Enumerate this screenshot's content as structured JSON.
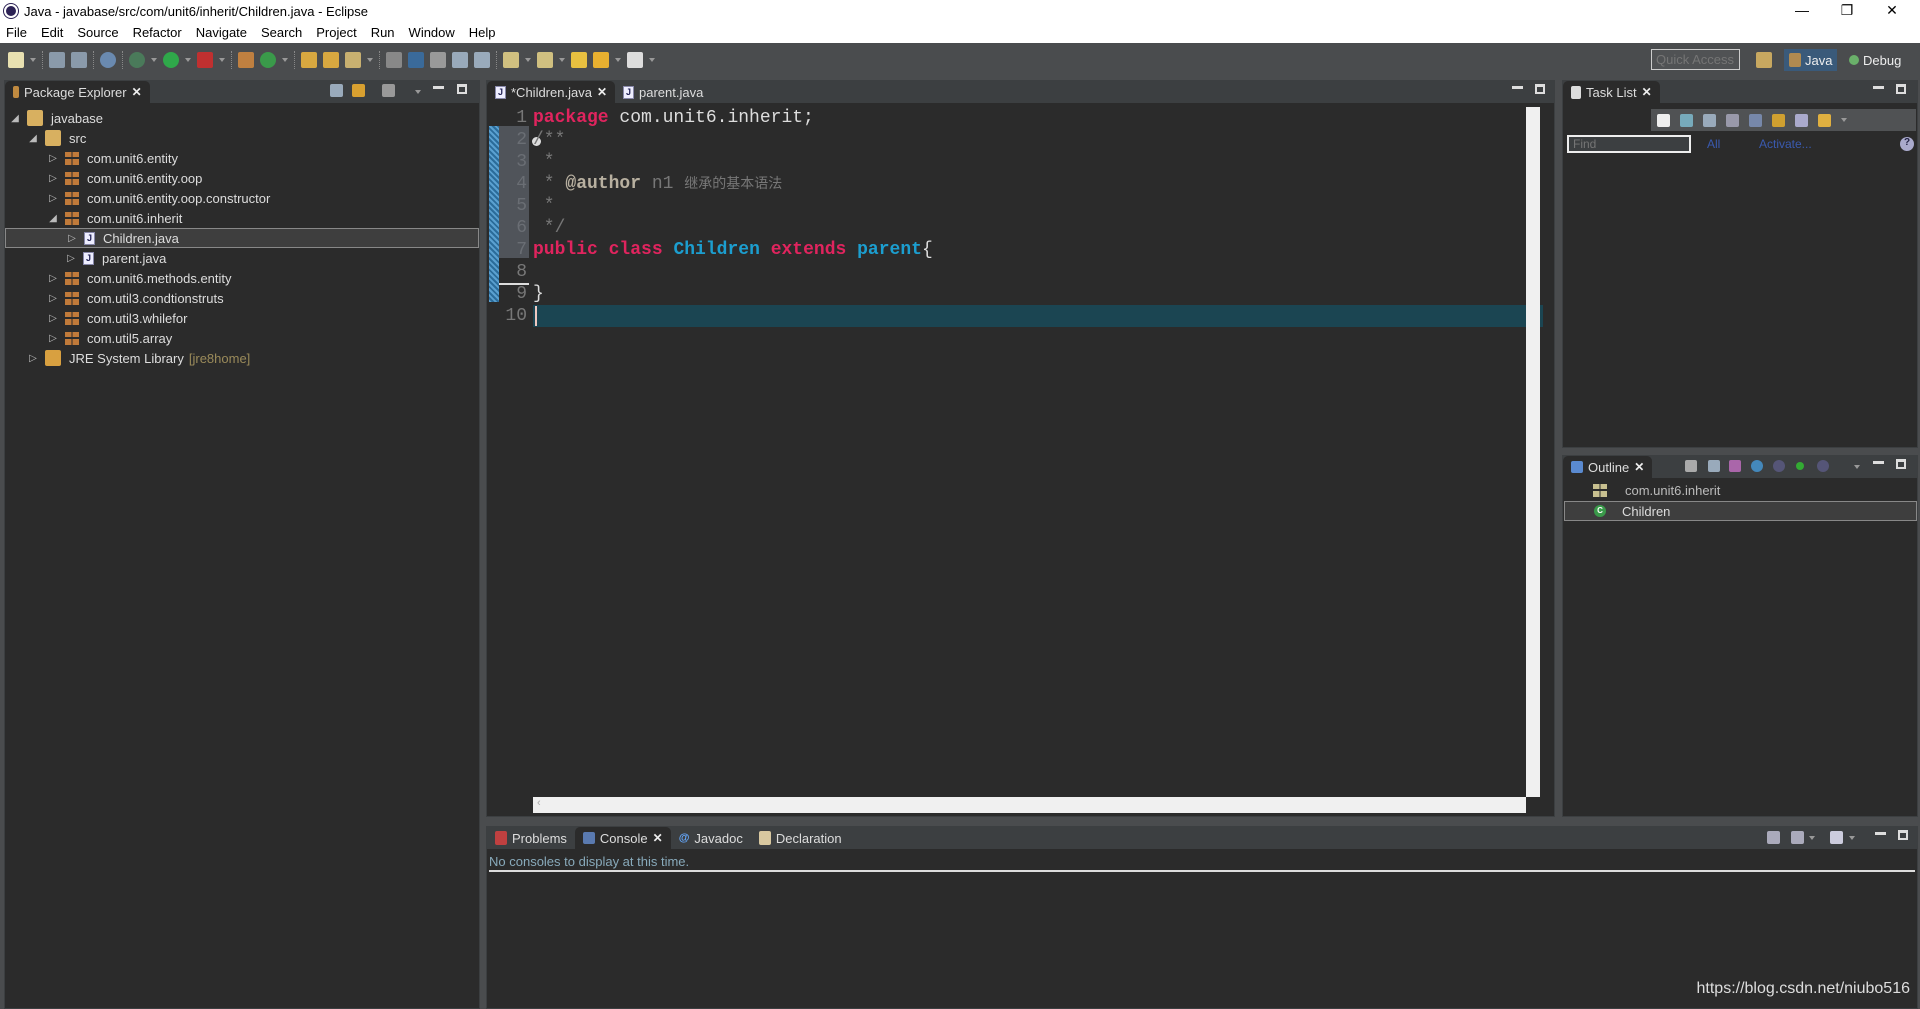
{
  "window": {
    "title": "Java - javabase/src/com/unit6/inherit/Children.java - Eclipse",
    "minimize": "—",
    "restore": "❐",
    "close": "✕"
  },
  "menu": [
    "File",
    "Edit",
    "Source",
    "Refactor",
    "Navigate",
    "Search",
    "Project",
    "Run",
    "Window",
    "Help"
  ],
  "toolbar": {
    "quick_access_placeholder": "Quick Access",
    "perspectives": [
      {
        "label": "Java",
        "active": true
      },
      {
        "label": "Debug",
        "active": false
      }
    ]
  },
  "package_explorer": {
    "title": "Package Explorer",
    "tree": [
      {
        "label": "javabase",
        "level": 0,
        "expanded": true,
        "type": "project"
      },
      {
        "label": "src",
        "level": 1,
        "expanded": true,
        "type": "folder"
      },
      {
        "label": "com.unit6.entity",
        "level": 2,
        "expanded": false,
        "type": "package"
      },
      {
        "label": "com.unit6.entity.oop",
        "level": 2,
        "expanded": false,
        "type": "package"
      },
      {
        "label": "com.unit6.entity.oop.constructor",
        "level": 2,
        "expanded": false,
        "type": "package"
      },
      {
        "label": "com.unit6.inherit",
        "level": 2,
        "expanded": true,
        "type": "package"
      },
      {
        "label": "Children.java",
        "level": 3,
        "expanded": false,
        "type": "java",
        "selected": true
      },
      {
        "label": "parent.java",
        "level": 3,
        "expanded": false,
        "type": "java"
      },
      {
        "label": "com.unit6.methods.entity",
        "level": 2,
        "expanded": false,
        "type": "package"
      },
      {
        "label": "com.util3.condtionstruts",
        "level": 2,
        "expanded": false,
        "type": "package"
      },
      {
        "label": "com.util3.whilefor",
        "level": 2,
        "expanded": false,
        "type": "package"
      },
      {
        "label": "com.util5.array",
        "level": 2,
        "expanded": false,
        "type": "package"
      },
      {
        "label": "JRE System Library",
        "suffix": "[jre8home]",
        "level": 1,
        "expanded": false,
        "type": "library"
      }
    ]
  },
  "editor": {
    "tabs": [
      {
        "label": "*Children.java",
        "active": true
      },
      {
        "label": "parent.java",
        "active": false
      }
    ],
    "lines": [
      {
        "n": "1",
        "tokens": [
          {
            "t": "package",
            "c": "kw"
          },
          {
            "t": " com.unit6.inherit;",
            "c": ""
          }
        ]
      },
      {
        "n": "2",
        "tokens": [
          {
            "t": "/**",
            "c": "cm"
          }
        ]
      },
      {
        "n": "3",
        "tokens": [
          {
            "t": " *",
            "c": "cm"
          }
        ]
      },
      {
        "n": "4",
        "tokens": [
          {
            "t": " * ",
            "c": "cm"
          },
          {
            "t": "@author",
            "c": "ann"
          },
          {
            "t": " n1 ",
            "c": "cm"
          },
          {
            "t": "继承的基本语法",
            "c": "cjk"
          }
        ]
      },
      {
        "n": "5",
        "tokens": [
          {
            "t": " *",
            "c": "cm"
          }
        ]
      },
      {
        "n": "6",
        "tokens": [
          {
            "t": " */",
            "c": "cm"
          }
        ]
      },
      {
        "n": "7",
        "tokens": [
          {
            "t": "public",
            "c": "kw"
          },
          {
            "t": " ",
            "c": ""
          },
          {
            "t": "class",
            "c": "kw"
          },
          {
            "t": " ",
            "c": ""
          },
          {
            "t": "Children",
            "c": "ty"
          },
          {
            "t": " ",
            "c": ""
          },
          {
            "t": "extends",
            "c": "kw"
          },
          {
            "t": " ",
            "c": ""
          },
          {
            "t": "parent",
            "c": "ty"
          },
          {
            "t": "{",
            "c": ""
          }
        ]
      },
      {
        "n": "8",
        "tokens": []
      },
      {
        "n": "9",
        "tokens": [
          {
            "t": "}",
            "c": ""
          }
        ]
      },
      {
        "n": "10",
        "tokens": [],
        "current": true
      }
    ]
  },
  "task_list": {
    "title": "Task List",
    "find_placeholder": "Find",
    "all_link": "All",
    "activate_link": "Activate..."
  },
  "outline": {
    "title": "Outline",
    "items": [
      {
        "label": "com.unit6.inherit",
        "type": "package"
      },
      {
        "label": "Children",
        "type": "class",
        "selected": true
      }
    ]
  },
  "bottom": {
    "tabs": [
      {
        "label": "Problems"
      },
      {
        "label": "Console",
        "active": true
      },
      {
        "label": "Javadoc"
      },
      {
        "label": "Declaration"
      }
    ],
    "message": "No consoles to display at this time."
  },
  "watermark": "https://blog.csdn.net/niubo516",
  "colors": {
    "keyword": "#e0245e",
    "type": "#1c9ecf",
    "current_line": "#1b4552",
    "background": "#2b2b2b"
  }
}
